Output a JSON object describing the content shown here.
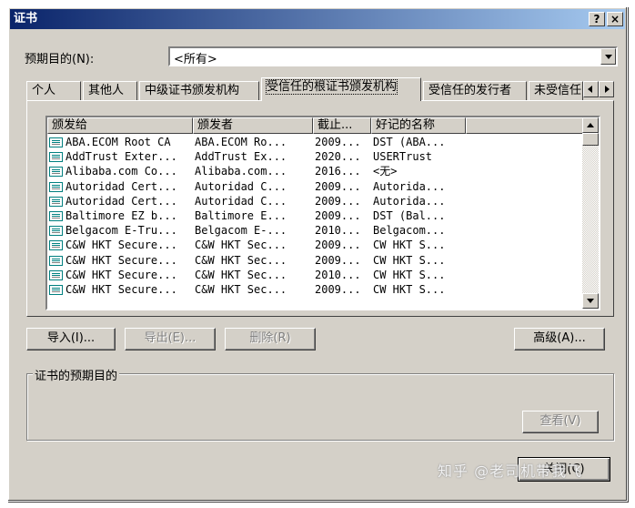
{
  "window": {
    "title": "证书",
    "help_btn": "?",
    "close_btn": "×"
  },
  "purpose": {
    "label": "预期目的(N):",
    "value": "<所有>"
  },
  "tabs": [
    {
      "label": "个人"
    },
    {
      "label": "其他人"
    },
    {
      "label": "中级证书颁发机构"
    },
    {
      "label": "受信任的根证书颁发机构"
    },
    {
      "label": "受信任的发行者"
    },
    {
      "label": "未受信任"
    }
  ],
  "list": {
    "columns": [
      "颁发给",
      "颁发者",
      "截止...",
      "好记的名称"
    ],
    "rows": [
      [
        "ABA.ECOM Root CA",
        "ABA.ECOM Ro...",
        "2009...",
        "DST (ABA..."
      ],
      [
        "AddTrust Exter...",
        "AddTrust Ex...",
        "2020...",
        "USERTrust"
      ],
      [
        "Alibaba.com Co...",
        "Alibaba.com...",
        "2016...",
        "<无>"
      ],
      [
        "Autoridad Cert...",
        "Autoridad C...",
        "2009...",
        "Autorida..."
      ],
      [
        "Autoridad Cert...",
        "Autoridad C...",
        "2009...",
        "Autorida..."
      ],
      [
        "Baltimore EZ b...",
        "Baltimore E...",
        "2009...",
        "DST (Bal..."
      ],
      [
        "Belgacom E-Tru...",
        "Belgacom E-...",
        "2010...",
        "Belgacom..."
      ],
      [
        "C&W HKT Secure...",
        "C&W HKT Sec...",
        "2009...",
        "CW HKT S..."
      ],
      [
        "C&W HKT Secure...",
        "C&W HKT Sec...",
        "2009...",
        "CW HKT S..."
      ],
      [
        "C&W HKT Secure...",
        "C&W HKT Sec...",
        "2010...",
        "CW HKT S..."
      ],
      [
        "C&W HKT Secure...",
        "C&W HKT Sec...",
        "2009...",
        "CW HKT S..."
      ]
    ]
  },
  "buttons": {
    "import": "导入(I)...",
    "export": "导出(E)...",
    "remove": "删除(R)",
    "advanced": "高级(A)...",
    "view": "查看(V)",
    "close": "关闭(C)"
  },
  "group": {
    "title": "证书的预期目的"
  },
  "watermark": "知乎 @老司机带我飞"
}
